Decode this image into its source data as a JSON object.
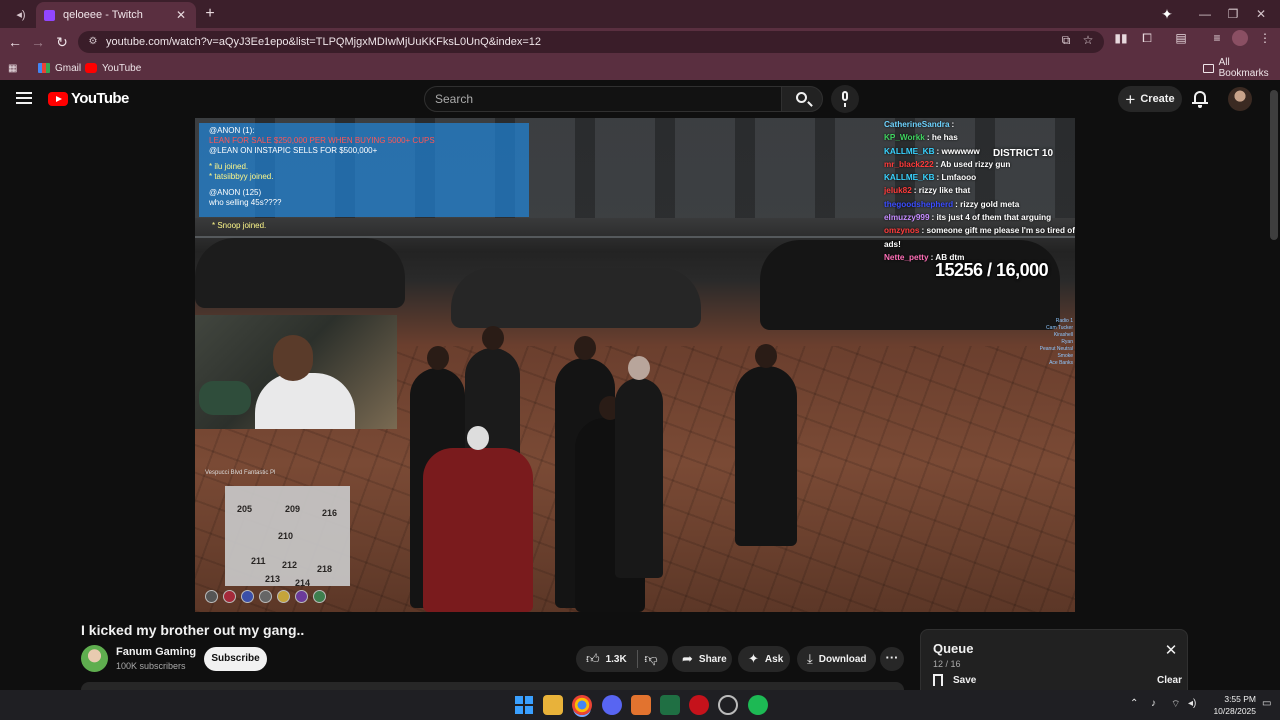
{
  "browser": {
    "tab_title": "qeloeee - Twitch",
    "url": "youtube.com/watch?v=aQyJ3Ee1epo&list=TLPQMjgxMDIwMjUuKKFksL0UnQ&index=12",
    "bookmarks": [
      {
        "label": "Gmail",
        "icon": "gmail-icon"
      },
      {
        "label": "YouTube",
        "icon": "youtube-icon"
      }
    ],
    "all_bookmarks": "All Bookmarks"
  },
  "youtube": {
    "logo": "YouTube",
    "search_placeholder": "Search",
    "create_label": "Create"
  },
  "video": {
    "overlay_chat": [
      "@ANON (1):",
      "LEAN FOR SALE $250,000 PER WHEN BUYING 5000+ CUPS",
      "@LEAN ON INSTAPIC SELLS FOR $500,000+",
      "* ilu joined.",
      "* tatsiibbyy joined.",
      "@ANON (125)",
      "who selling 45s????"
    ],
    "snoop": "* Snoop joined.",
    "district": "DISTRICT 10",
    "counter": "15256 / 16,000",
    "minimap_location": "Vespucci Blvd Fantastic Pl",
    "minimap_numbers": [
      "205",
      "209",
      "216",
      "210",
      "211",
      "212",
      "218",
      "213",
      "214"
    ],
    "hud_values": [
      "0%",
      "100%",
      "5%",
      "0%",
      "0%",
      "40%",
      "100%"
    ],
    "twitch_chat": [
      {
        "name": "CatherineSandra",
        "msg": "",
        "color": "#6fd4ff"
      },
      {
        "name": "KP_Workk",
        "msg": "he has",
        "color": "#3fd35f"
      },
      {
        "name": "KALLME_KB",
        "msg": "wwwwww",
        "color": "#39d3ff"
      },
      {
        "name": "mr_black222",
        "msg": "Ab used rizzy gun",
        "color": "#ff3b3b"
      },
      {
        "name": "KALLME_KB",
        "msg": "Lmfaooo",
        "color": "#39d3ff"
      },
      {
        "name": "jeluk82",
        "msg": "rizzy like that",
        "color": "#ff3b3b"
      },
      {
        "name": "thegoodshepherd",
        "msg": "rizzy gold meta",
        "color": "#3b4dff"
      },
      {
        "name": "elmuzzy999",
        "msg": "its just 4 of them that arguing",
        "color": "#c58bff"
      },
      {
        "name": "omzynos",
        "msg": "someone gift me please I'm so tired of ads!",
        "color": "#ff3b3b"
      },
      {
        "name": "Nette_petty",
        "msg": "AB dtm",
        "color": "#ff6fb7"
      }
    ],
    "radio_list": [
      "Radio 1",
      "Cam Tucker",
      "Kirashell",
      "Ryan",
      "Peanut Neutral",
      "Smoke",
      "Ace Banks"
    ]
  },
  "meta": {
    "title": "I kicked my brother out my gang..",
    "channel": "Fanum Gaming",
    "subscribers": "100K subscribers",
    "subscribe_label": "Subscribe",
    "likes": "1.3K",
    "share_label": "Share",
    "ask_label": "Ask",
    "download_label": "Download"
  },
  "queue": {
    "title": "Queue",
    "count": "12 / 16",
    "save_label": "Save",
    "clear_label": "Clear"
  },
  "taskbar": {
    "time": "3:55 PM",
    "date": "10/28/2025",
    "apps": [
      "windows-icon",
      "file-explorer-icon",
      "chrome-icon",
      "discord-icon",
      "app-orange-icon",
      "excel-icon",
      "youtube-music-icon",
      "app-clock-icon",
      "spotify-icon"
    ]
  }
}
